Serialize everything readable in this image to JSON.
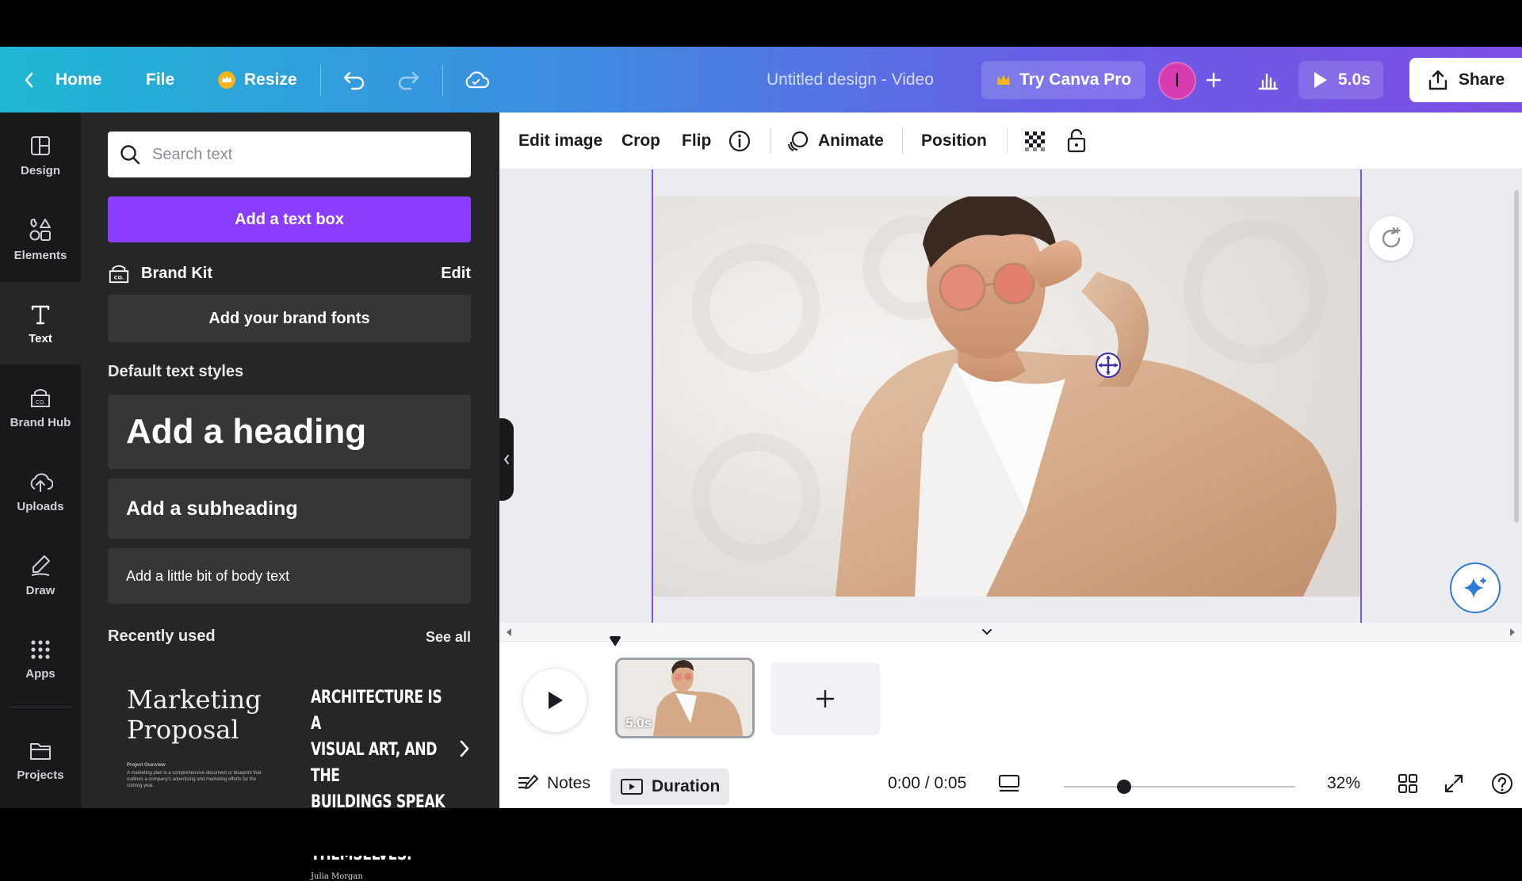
{
  "topbar": {
    "home_label": "Home",
    "file_label": "File",
    "resize_label": "Resize",
    "title": "Untitled design - Video",
    "try_pro_label": "Try Canva Pro",
    "avatar_initial": "I",
    "duration_label": "5.0s",
    "share_label": "Share"
  },
  "rail": {
    "items": [
      {
        "label": "Design",
        "icon": "design-icon"
      },
      {
        "label": "Elements",
        "icon": "elements-icon"
      },
      {
        "label": "Text",
        "icon": "text-icon"
      },
      {
        "label": "Brand Hub",
        "icon": "brand-hub-icon"
      },
      {
        "label": "Uploads",
        "icon": "uploads-icon"
      },
      {
        "label": "Draw",
        "icon": "draw-icon"
      },
      {
        "label": "Apps",
        "icon": "apps-icon"
      },
      {
        "label": "Projects",
        "icon": "projects-icon"
      }
    ],
    "active": "Text"
  },
  "panel": {
    "search_placeholder": "Search text",
    "add_textbox_label": "Add a text box",
    "brand_kit_label": "Brand Kit",
    "brand_kit_edit": "Edit",
    "brand_fonts_label": "Add your brand fonts",
    "default_styles_title": "Default text styles",
    "heading_label": "Add a heading",
    "subheading_label": "Add a subheading",
    "body_label": "Add a little bit of body text",
    "recently_used_title": "Recently used",
    "see_all_label": "See all",
    "recent": [
      {
        "title_line1": "Marketing",
        "title_line2": "Proposal",
        "sub_heading": "Project Overview",
        "sub_body": "A marketing plan is a comprehensive document or blueprint that outlines a company's advertising and marketing efforts for the coming year."
      },
      {
        "line1": "ARCHITECTURE IS A",
        "line2": "VISUAL ART, AND THE",
        "line3": "BUILDINGS SPEAK FOR",
        "line4": "THEMSELVES.",
        "signature": "Julia Morgan"
      }
    ]
  },
  "toolbar": {
    "edit_image_label": "Edit image",
    "crop_label": "Crop",
    "flip_label": "Flip",
    "animate_label": "Animate",
    "position_label": "Position"
  },
  "timeline": {
    "clip_duration": "5.0s"
  },
  "bottombar": {
    "notes_label": "Notes",
    "duration_label": "Duration",
    "time_readout": "0:00 / 0:05",
    "zoom_level": "32%",
    "zoom_fraction": 0.26
  },
  "colors": {
    "brand_purple": "#8b3dff",
    "selection_purple": "#7b4fe3",
    "avatar_pink": "#d63bb0",
    "crown_gold": "#f5b31c"
  }
}
